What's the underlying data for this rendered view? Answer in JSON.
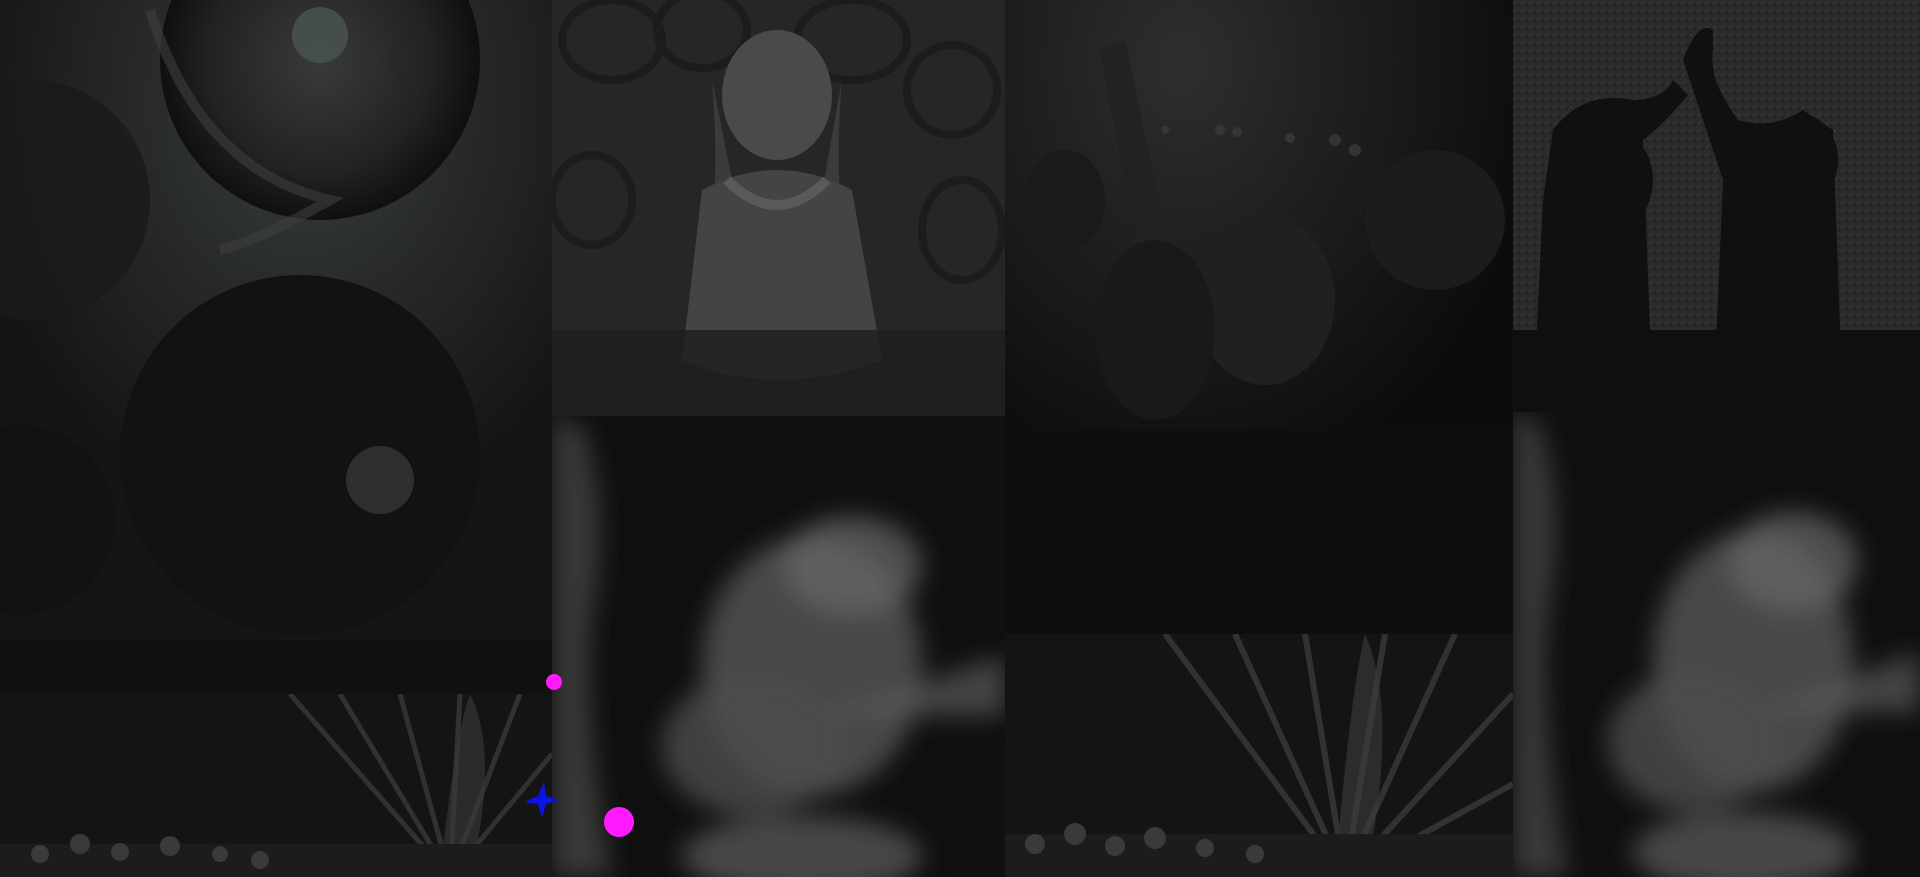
{
  "gallery": {
    "tiles": [
      {
        "id": "t1",
        "icon": "photo-dancers-flower-costumes",
        "tone": "#2a2a2a"
      },
      {
        "id": "t2",
        "icon": "photo-concert-stage-lights",
        "tone": "#1c1c1c"
      },
      {
        "id": "t3",
        "icon": "photo-child-dancing-beads",
        "tone": "#2c2c2c"
      },
      {
        "id": "t4",
        "icon": "photo-blurred-dancer-motion",
        "tone": "#3a3a3a"
      },
      {
        "id": "t5",
        "icon": "photo-crowd-raised-arm",
        "tone": "#1e1e1e"
      },
      {
        "id": "t6",
        "icon": "photo-concert-stage-lights",
        "tone": "#1c1c1c"
      },
      {
        "id": "t7",
        "icon": "photo-silhouettes-dancing",
        "tone": "#2a2a2a"
      },
      {
        "id": "t8",
        "icon": "photo-blurred-dancer-motion",
        "tone": "#3a3a3a"
      }
    ]
  },
  "overlay": {
    "cursor_color": "#ff1aff",
    "sparkle_color": "#0a14e6",
    "cursor_icon": "cursor-dot-icon",
    "sparkle_icon": "sparkle-star-icon"
  }
}
